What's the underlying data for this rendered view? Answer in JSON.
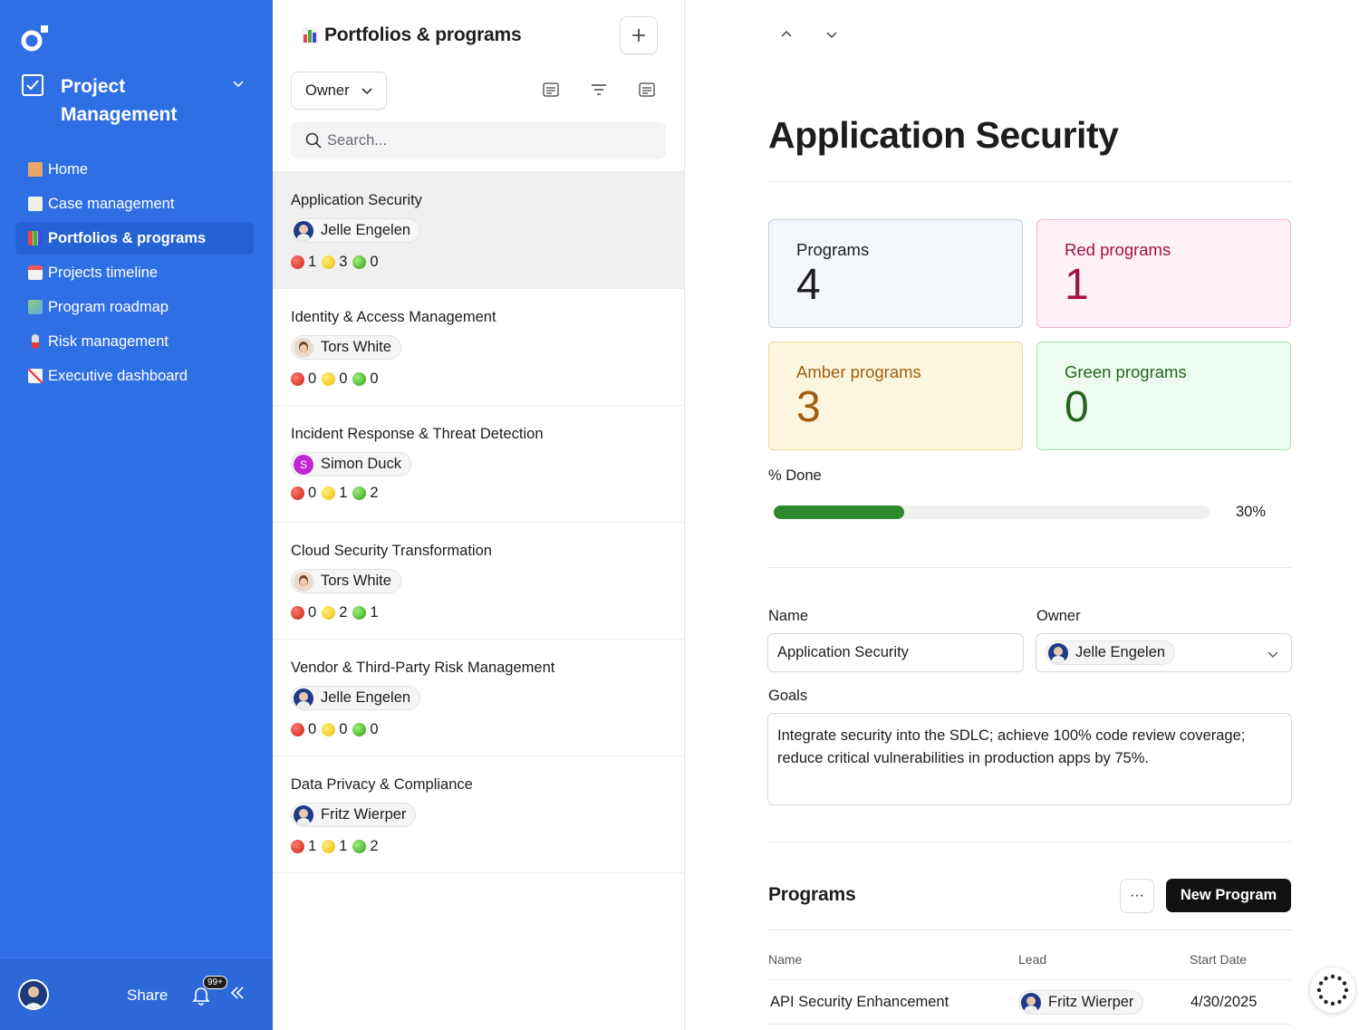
{
  "sidebar": {
    "workspace_title": "Project Management",
    "items": [
      {
        "label": "Home",
        "icon": "house-emoji"
      },
      {
        "label": "Case management",
        "icon": "memo-emoji"
      },
      {
        "label": "Portfolios & programs",
        "icon": "bar-chart-emoji",
        "active": true
      },
      {
        "label": "Projects timeline",
        "icon": "calendar-emoji"
      },
      {
        "label": "Program roadmap",
        "icon": "map-emoji"
      },
      {
        "label": "Risk management",
        "icon": "thermometer-emoji"
      },
      {
        "label": "Executive dashboard",
        "icon": "chart-increasing-emoji"
      }
    ],
    "footer": {
      "share": "Share",
      "notifications_badge": "99+"
    }
  },
  "list": {
    "title": "Portfolios & programs",
    "owner_filter": "Owner",
    "search_placeholder": "Search...",
    "rows": [
      {
        "name": "Application Security",
        "owner": "Jelle Engelen",
        "red": "1",
        "amber": "3",
        "green": "0"
      },
      {
        "name": "Identity & Access Management",
        "owner": "Tors White",
        "red": "0",
        "amber": "0",
        "green": "0"
      },
      {
        "name": "Incident Response & Threat Detection",
        "owner": "Simon Duck",
        "owner_initial": "S",
        "red": "0",
        "amber": "1",
        "green": "2"
      },
      {
        "name": "Cloud Security Transformation",
        "owner": "Tors White",
        "red": "0",
        "amber": "2",
        "green": "1"
      },
      {
        "name": "Vendor & Third-Party Risk Management",
        "owner": "Jelle Engelen",
        "red": "0",
        "amber": "0",
        "green": "0"
      },
      {
        "name": "Data Privacy & Compliance",
        "owner": "Fritz Wierper",
        "red": "1",
        "amber": "1",
        "green": "2"
      }
    ]
  },
  "detail": {
    "title": "Application Security",
    "cards": {
      "programs": {
        "label": "Programs",
        "value": "4"
      },
      "red": {
        "label": "Red programs",
        "value": "1"
      },
      "amber": {
        "label": "Amber programs",
        "value": "3"
      },
      "green": {
        "label": "Green programs",
        "value": "0"
      }
    },
    "done_label": "% Done",
    "done_value": 0.3,
    "done_text": "30%",
    "fields": {
      "name_label": "Name",
      "name_value": "Application Security",
      "owner_label": "Owner",
      "owner_value": "Jelle Engelen",
      "goals_label": "Goals",
      "goals_value": "Integrate security into the SDLC; achieve 100% code review coverage; reduce critical vulnerabilities in production apps by 75%."
    },
    "programs": {
      "title": "Programs",
      "more": "···",
      "new_button": "New Program",
      "columns": [
        "Name",
        "Lead",
        "Start Date"
      ],
      "rows": [
        {
          "name": "API Security Enhancement",
          "lead": "Fritz Wierper",
          "start": "4/30/2025"
        }
      ]
    }
  },
  "colors": {
    "sidebar_bg": "#2f6fe4",
    "red_card": "#a4133f",
    "amber_card": "#a15c0f",
    "green_card": "#23661c",
    "progress": "#2f8a2f"
  }
}
